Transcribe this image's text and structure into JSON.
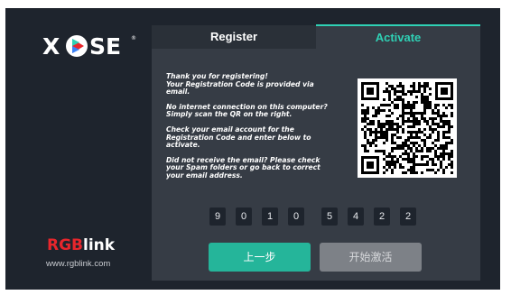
{
  "brand": {
    "logo_text": "XPOSE",
    "vendor_logo_red": "RGB",
    "vendor_logo_white": "link",
    "vendor_url": "www.rgblink.com"
  },
  "tabs": [
    {
      "label": "Register",
      "active": false
    },
    {
      "label": "Activate",
      "active": true
    }
  ],
  "info": {
    "p1": "Thank you for registering!\nYour Registration Code is provided via\nemail.",
    "p2": "No internet connection on this computer?\nSimply scan the QR on the right.",
    "p3": "Check your email account for the\nRegistration Code and enter below to\nactivate.",
    "p4": "Did not receive the email? Please check\nyour Spam folders or go back to correct\nyour email address."
  },
  "code_digits": [
    "9",
    "0",
    "1",
    "0",
    "5",
    "4",
    "2",
    "2"
  ],
  "buttons": {
    "back_label": "上一步",
    "activate_label": "开始激活"
  },
  "colors": {
    "accent": "#2fd1b5",
    "primary_button": "#25b59a",
    "disabled_button": "#7d8187",
    "background": "#1e242d",
    "panel": "#363c45",
    "vendor_red": "#e8262c"
  },
  "icons": {
    "qr_code": "qr-code-icon"
  }
}
